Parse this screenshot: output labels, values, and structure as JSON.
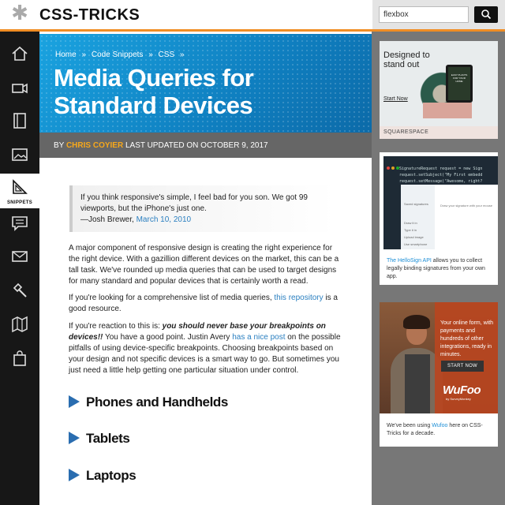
{
  "header": {
    "logo_text": "CSS-TRICKS",
    "logo_icon": "asterisk-icon",
    "search_value": "flexbox",
    "search_icon": "search-icon"
  },
  "sidebar": {
    "items": [
      {
        "icon": "home-icon",
        "label": ""
      },
      {
        "icon": "video-camera-icon",
        "label": ""
      },
      {
        "icon": "book-icon",
        "label": ""
      },
      {
        "icon": "image-icon",
        "label": ""
      },
      {
        "icon": "snippets-icon",
        "label": "SNIPPETS",
        "active": true
      },
      {
        "icon": "chat-icon",
        "label": ""
      },
      {
        "icon": "mail-icon",
        "label": ""
      },
      {
        "icon": "hammer-icon",
        "label": ""
      },
      {
        "icon": "map-icon",
        "label": ""
      },
      {
        "icon": "shopping-bag-icon",
        "label": ""
      }
    ]
  },
  "hero": {
    "breadcrumb": [
      "Home",
      "»",
      "Code Snippets",
      "»",
      "CSS",
      "»"
    ],
    "title": "Media Queries for Standard Devices"
  },
  "byline": {
    "by": "BY",
    "author": "CHRIS COYIER",
    "updated": "LAST UPDATED ON OCTOBER 9, 2017"
  },
  "article": {
    "quote_text": "If you think responsive's simple, I feel bad for you son. We got 99 viewports, but the iPhone's just one.",
    "quote_author": "—Josh Brewer,",
    "quote_date": "March 10, 2010",
    "p1": "A major component of responsive design is creating the right experience for the right device. With a gazillion different devices on the market, this can be a tall task. We've rounded up media queries that can be used to target designs for many standard and popular devices that is certainly worth a read.",
    "p2_before": "If you're looking for a comprehensive list of media queries,",
    "p2_link": "this repository",
    "p2_after": "is a good resource.",
    "p3_before": "If you're reaction to this is:",
    "p3_em": "you should never base your breakpoints on devices!!",
    "p3_mid": "You have a good point. Justin Avery",
    "p3_link": "has a nice post",
    "p3_after": "on the possible pitfalls of using device-specific breakpoints. Choosing breakpoints based on your design and not specific devices is a smart way to go. But sometimes you just need a little help getting one particular situation under control.",
    "headings": [
      "Phones and Handhelds",
      "Tablets",
      "Laptops"
    ]
  },
  "ads": {
    "ad1": {
      "title": "Designed to stand out",
      "learn": "Start Now",
      "tablet_text": "EASY PLANTS FOR YOUR HOME",
      "brand": "SQUARESPACE"
    },
    "ad2": {
      "code_lines": [
        "SignatureRequest request = new Sign",
        "request.setSubject(\"My First embedd",
        "request.setMessage(\"Awesome, right?"
      ],
      "panel_items": [
        "Saved signatures",
        "Draw it in",
        "Type it in",
        "Upload image",
        "Use smartphone"
      ],
      "panel_hint": "Draw your signature with your mouse",
      "link": "The HelloSign API",
      "text": "allows you to collect legally binding signatures from your own app."
    },
    "ad3": {
      "copy": "Your online form, with payments and hundreds of other integrations, ready in minutes.",
      "button": "START NOW",
      "brand": "WuFoo",
      "sub": "by SurveyMonkey",
      "text_before": "We've been using",
      "link": "Wufoo",
      "text_after": "here on CSS-Tricks for a decade."
    }
  },
  "colors": {
    "accent": "#f08d24",
    "hero_blue": "#1aa3e0",
    "link": "#2a7fc0",
    "author": "#f6a81b",
    "sidebar_bg": "#171717"
  }
}
